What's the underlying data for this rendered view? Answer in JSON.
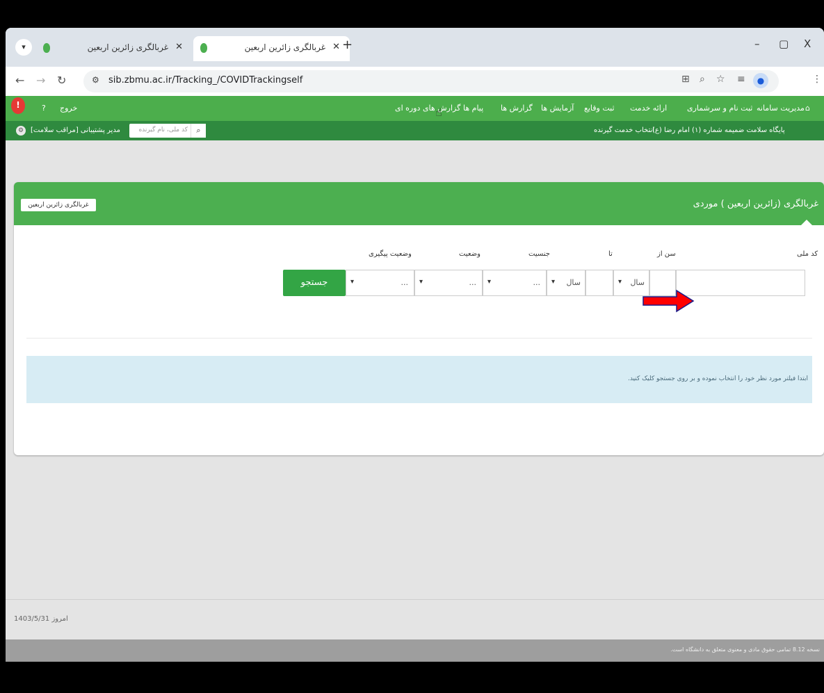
{
  "browser": {
    "tabs": [
      {
        "title": "غربالگری زائرین اربعین",
        "active": false
      },
      {
        "title": "غربالگری زائرین اربعین",
        "active": true
      }
    ],
    "new_tab": "+",
    "window_controls": {
      "minimize": "–",
      "maximize": "▢",
      "close": "X"
    },
    "url": "sib.zbmu.ac.ir/Tracking_/COVIDTrackingself"
  },
  "app": {
    "exit_label": "خروج",
    "main_menu": [
      "مدیریت سامانه",
      "ثبت نام و سرشماری",
      "ارائه خدمت",
      "ثبت وقایع",
      "آزمایش ها",
      "گزارش ها",
      "پیام ها",
      "گزارش های دوره ای"
    ],
    "facility": "پایگاه سلامت ضمیمه شماره (۱) امام رضا (ع)",
    "service_recipient": "انتخاب خدمت گیرنده",
    "user_role": "مدیر پشتیبانی [مراقب سلامت]",
    "search_placeholder": "کد ملی، نام گیرنده"
  },
  "panel": {
    "title": "غربالگری (زائرین اربعین ) موردی",
    "header_button": "غربالگری زائرین اربعین",
    "fields": {
      "national_code": "کد ملی",
      "age_from": "سن از",
      "age_to": "تا",
      "gender": "جنسیت",
      "status": "وضعیت",
      "followup_status": "وضعیت پیگیری"
    },
    "placeholders": {
      "year": "سال",
      "dots": "..."
    },
    "search_button": "جستجو",
    "info_message": "ابتدا فیلتر مورد نظر خود را انتخاب نموده و بر روی جستجو کلیک کنید."
  },
  "footer": {
    "date": "امروز 1403/5/31",
    "version": "نسخه 8.12 تمامی حقوق مادی و معنوی متعلق به دانشگاه است."
  },
  "colors": {
    "primary_green": "#4caf50",
    "dark_green": "#2f8a3f",
    "button_green": "#33a545",
    "info_bg": "#d7ecf4",
    "arrow_red": "#ff0000"
  }
}
